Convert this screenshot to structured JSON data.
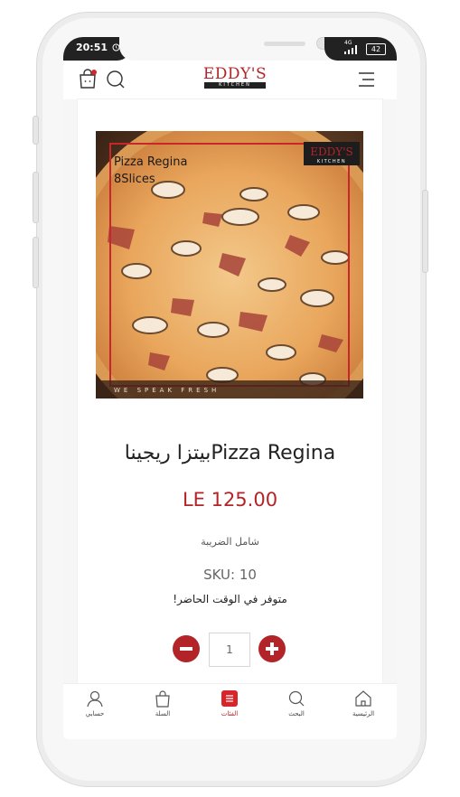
{
  "status_bar": {
    "time": "20:51",
    "battery": "42",
    "network": "4G"
  },
  "header": {
    "brand_line1": "EDDY'S",
    "brand_line2": "KITCHEN"
  },
  "product": {
    "image_caption_line1": "Pizza Regina",
    "image_caption_line2": "8Slices",
    "image_logo_line1": "EDDY'S",
    "image_logo_line2": "KITCHEN",
    "image_slogan": "WE SPEAK FRESH",
    "title": "بيتزا ريجيناPizza Regina",
    "price": "LE 125.00",
    "tax_note": "شامل الضريبة",
    "sku": "SKU: 10",
    "availability": "!متوفر في الوقت الحاضر",
    "quantity": "1"
  },
  "bottom_nav": {
    "account": "حسابي",
    "cart": "السلة",
    "categories": "الفئات",
    "search": "البحث",
    "home": "الرئيسية"
  },
  "colors": {
    "accent": "#b32428"
  }
}
